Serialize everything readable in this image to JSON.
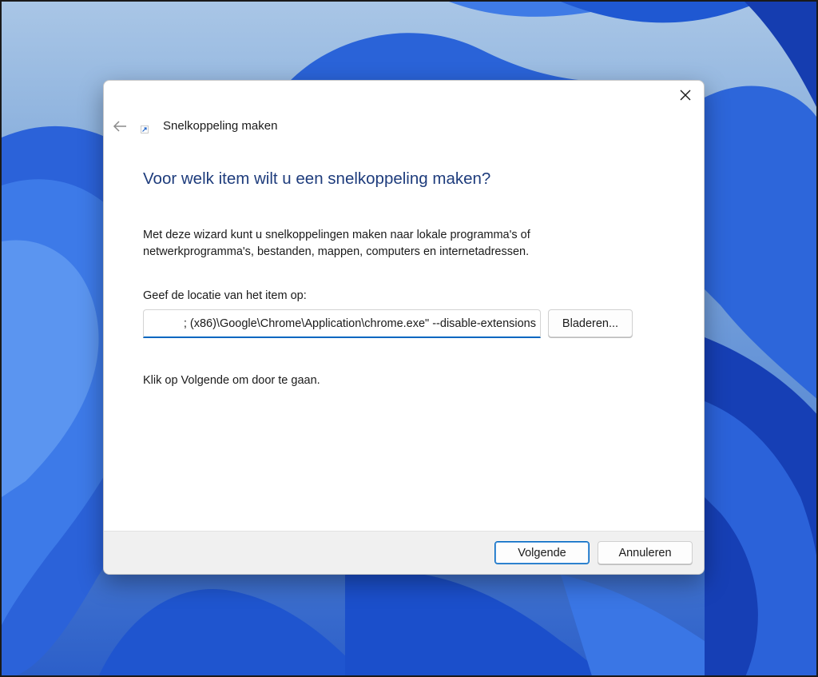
{
  "dialog": {
    "title": "Snelkoppeling maken",
    "heading": "Voor welk item wilt u een snelkoppeling maken?",
    "description": "Met deze wizard kunt u snelkoppelingen maken naar lokale programma's of netwerkprogramma's, bestanden, mappen, computers en internetadressen.",
    "location_label": "Geef de locatie van het item op:",
    "location_value": "; (x86)\\Google\\Chrome\\Application\\chrome.exe\" --disable-extensions",
    "browse_label": "Bladeren...",
    "hint": "Klik op Volgende om door te gaan."
  },
  "footer": {
    "next_label": "Volgende",
    "cancel_label": "Annuleren"
  },
  "icons": {
    "close": "close-icon",
    "back": "back-arrow-icon",
    "shortcut": "shortcut-icon"
  },
  "colors": {
    "heading": "#1e3c7c",
    "accent": "#0067c0",
    "wallpaper": "#1f5fd6"
  }
}
